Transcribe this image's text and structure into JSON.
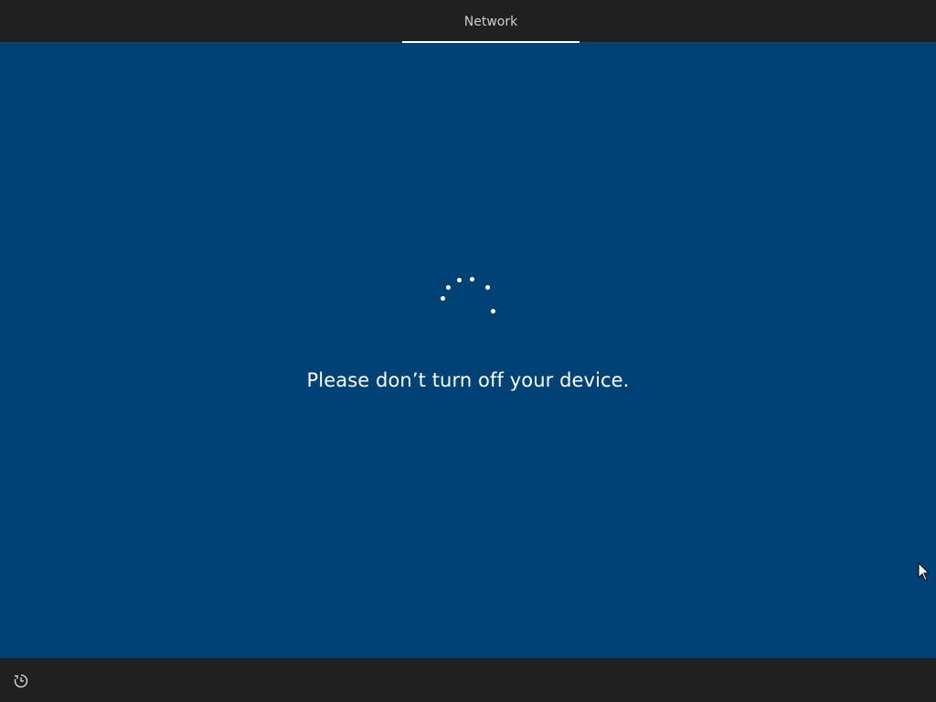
{
  "header": {
    "tabs": [
      {
        "label": "Network",
        "active": true
      }
    ]
  },
  "main": {
    "status_message": "Please don’t turn off your device.",
    "spinner_icon": "loading-spinner-icon"
  },
  "footer": {
    "ease_of_access_icon": "ease-of-access-icon"
  },
  "colors": {
    "background": "#004275",
    "bars": "#202020",
    "text": "#ffffff"
  }
}
